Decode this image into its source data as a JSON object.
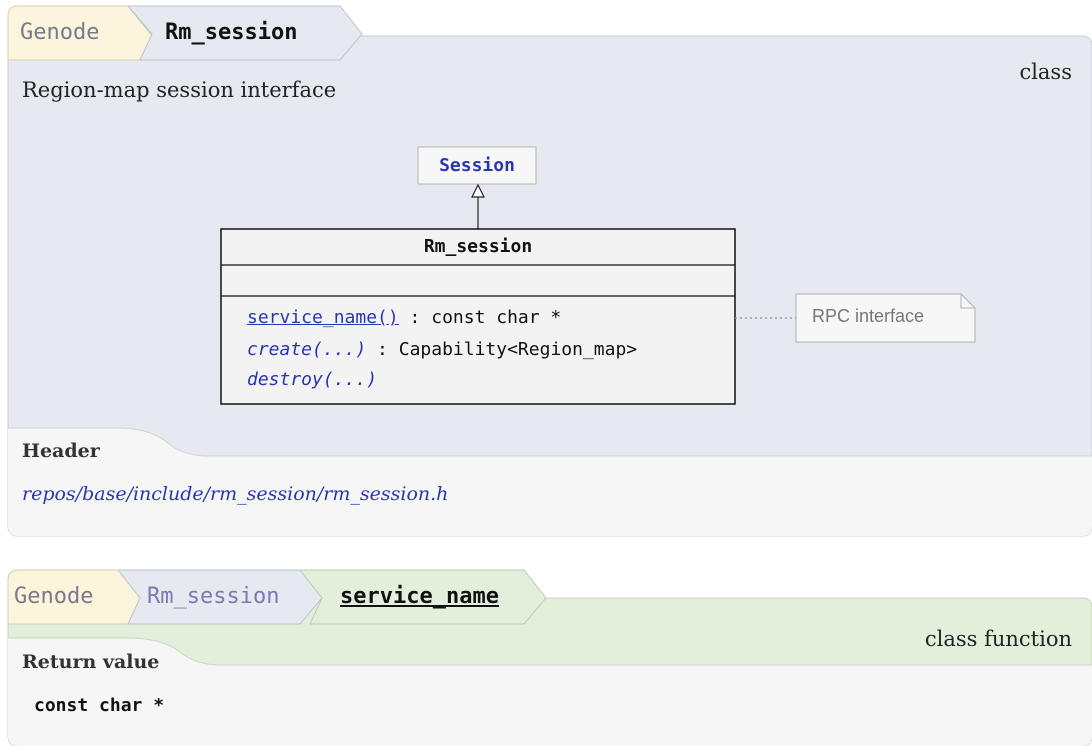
{
  "class_block": {
    "breadcrumb": {
      "namespace": "Genode",
      "current": "Rm_session"
    },
    "kind": "class",
    "description": "Region-map session interface",
    "diagram": {
      "base_class": "Session",
      "class_name": "Rm_session",
      "methods": [
        {
          "name": "service_name()",
          "return_type": " : const char *",
          "style": "link"
        },
        {
          "name": "create(...)",
          "return_type": " : Capability<Region_map>",
          "style": "italic"
        },
        {
          "name": "destroy(...)",
          "return_type": "",
          "style": "italic"
        }
      ],
      "note": "RPC interface"
    },
    "header_label": "Header",
    "header_path": "repos/base/include/rm_session/rm_session.h"
  },
  "function_block": {
    "breadcrumb": {
      "namespace": "Genode",
      "class": "Rm_session",
      "current": "service_name"
    },
    "kind": "class function",
    "return_label": "Return value",
    "return_type": "const char *"
  },
  "colors": {
    "class_panel": "#e6e9f0",
    "function_panel": "#e3eedb",
    "namespace_tab": "#fcf5dc",
    "link": "#2a36b1"
  }
}
